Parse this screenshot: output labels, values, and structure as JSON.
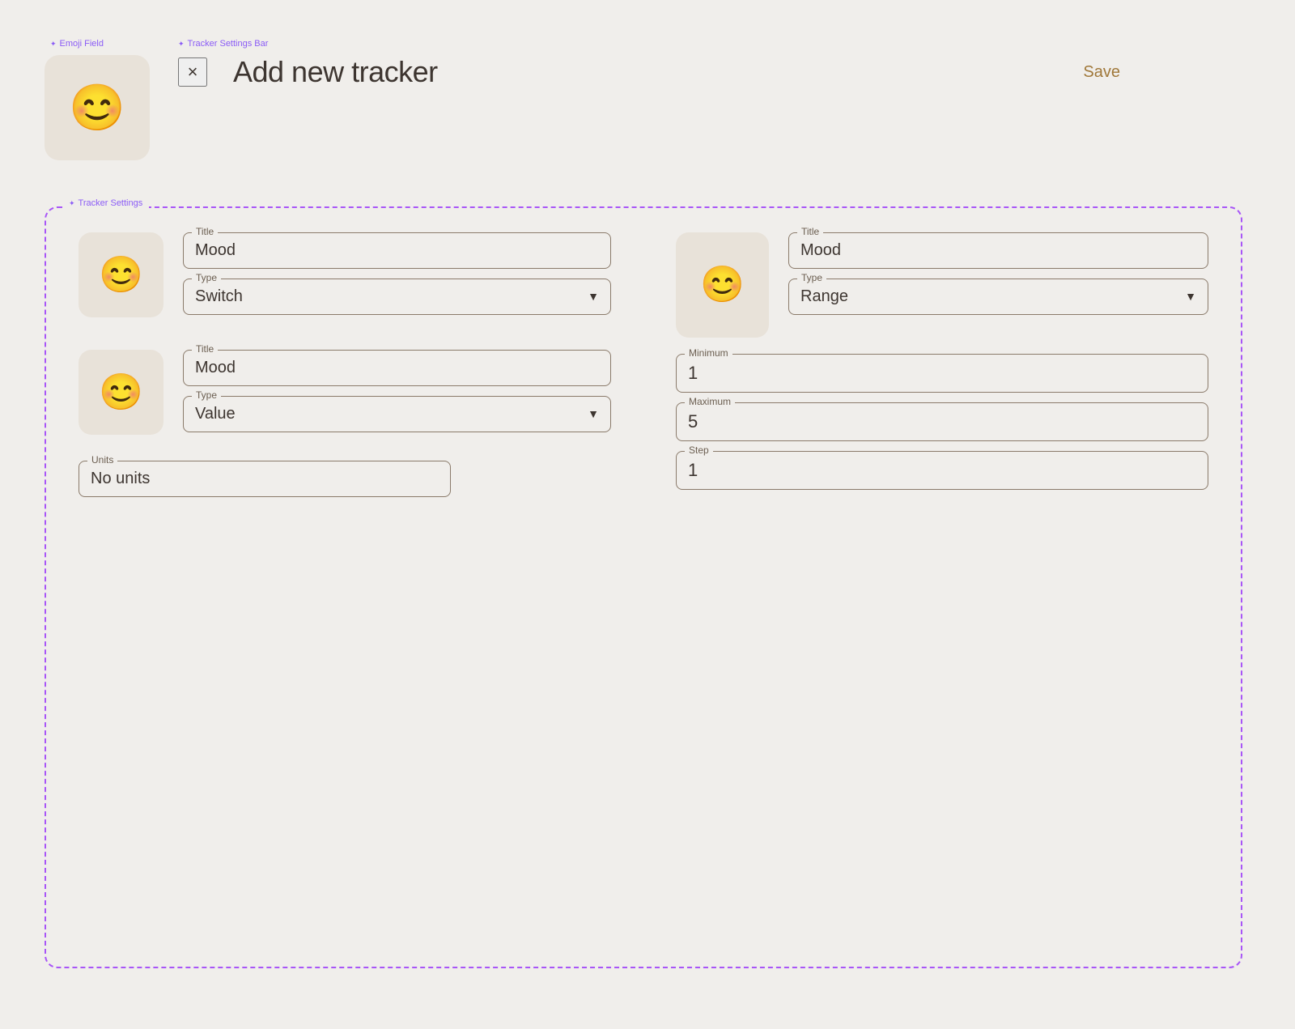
{
  "labels": {
    "emoji_field": "Emoji Field",
    "tracker_settings_bar": "Tracker Settings Bar",
    "tracker_settings": "Tracker Settings"
  },
  "header": {
    "close_label": "×",
    "title": "Add new tracker",
    "save_label": "Save"
  },
  "left_tracker_1": {
    "emoji": "😊",
    "title_label": "Title",
    "title_value": "Mood",
    "type_label": "Type",
    "type_value": "Switch"
  },
  "left_tracker_2": {
    "emoji": "😊",
    "title_label": "Title",
    "title_value": "Mood",
    "type_label": "Type",
    "type_value": "Value",
    "units_label": "Units",
    "units_value": "No units"
  },
  "right_tracker": {
    "emoji": "😊",
    "title_label": "Title",
    "title_value": "Mood",
    "type_label": "Type",
    "type_value": "Range",
    "minimum_label": "Minimum",
    "minimum_value": "1",
    "maximum_label": "Maximum",
    "maximum_value": "5",
    "step_label": "Step",
    "step_value": "1"
  }
}
